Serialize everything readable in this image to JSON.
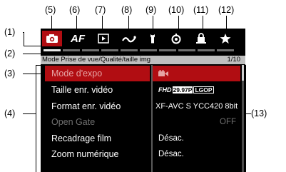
{
  "callouts": {
    "c1": "(1)",
    "c2": "(2)",
    "c3": "(3)",
    "c4": "(4)",
    "c5": "(5)",
    "c6": "(6)",
    "c7": "(7)",
    "c8": "(8)",
    "c9": "(9)",
    "c10": "(10)",
    "c11": "(11)",
    "c12": "(12)",
    "c13": "(13)"
  },
  "tabs": [
    {
      "icon": "camera-icon",
      "active": true
    },
    {
      "label": "AF",
      "icon": "af-icon"
    },
    {
      "icon": "playback-icon"
    },
    {
      "icon": "wireless-icon"
    },
    {
      "icon": "wrench-icon"
    },
    {
      "icon": "custom-function-icon"
    },
    {
      "icon": "my-menu-icon"
    },
    {
      "icon": "star-icon"
    }
  ],
  "title_bar": {
    "name": "Mode Prise de vue/Qualité/taille img",
    "page": "1/10"
  },
  "menu": [
    {
      "label": "Mode d'expo",
      "value_icon": "movie-mode-icon",
      "selected": true
    },
    {
      "label": "Taille enr. vidéo",
      "value": {
        "prefix": "FHD",
        "fps": "29.97P",
        "codec": "LGOP"
      }
    },
    {
      "label": "Format enr. vidéo",
      "value_text": "XF-AVC S YCC420 8bit"
    },
    {
      "label": "Open Gate",
      "value_text": "OFF",
      "disabled": true
    },
    {
      "label": "Recadrage film",
      "value_text": "Désac."
    },
    {
      "label": "Zoom numérique",
      "value_text": "Désac."
    }
  ],
  "colors": {
    "accent": "#b10d12",
    "background": "#000000",
    "title_bar": "#bfbfbf"
  }
}
